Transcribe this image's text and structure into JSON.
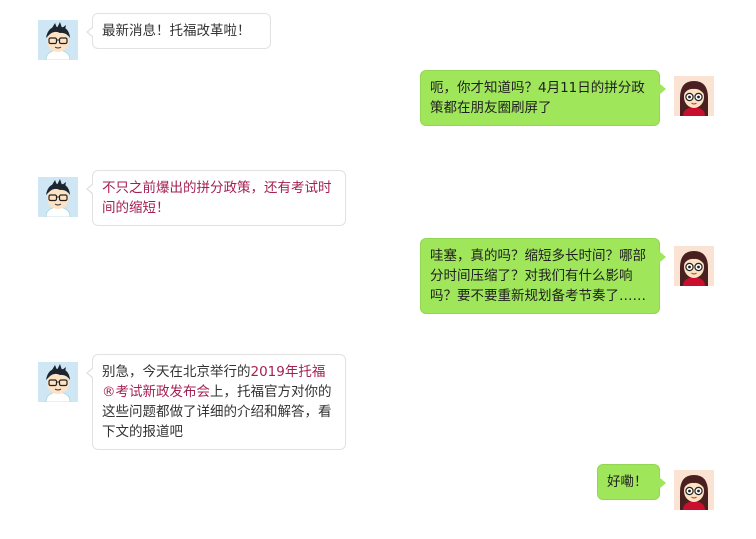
{
  "colors": {
    "left_bubble_bg": "#ffffff",
    "right_bubble_bg": "#9fe65a",
    "highlight_text": "#a51f52"
  },
  "messages": [
    {
      "side": "left",
      "avatar": "boy-avatar",
      "text": "最新消息！托福改革啦！"
    },
    {
      "side": "right",
      "avatar": "girl-avatar",
      "text": "呃，你才知道吗？4月11日的拼分政策都在朋友圈刷屏了"
    },
    {
      "side": "left",
      "avatar": "boy-avatar",
      "text": "不只之前爆出的拼分政策，还有考试时间的缩短！"
    },
    {
      "side": "right",
      "avatar": "girl-avatar",
      "text": "哇塞，真的吗？缩短多长时间？哪部分时间压缩了？对我们有什么影响吗？要不要重新规划备考节奏了……"
    },
    {
      "side": "left",
      "avatar": "boy-avatar",
      "text_before": "别急，今天在北京举行的",
      "text_highlight": "2019年托福®考试新政发布会",
      "text_after": "上，托福官方对你的这些问题都做了详细的介绍和解答，看下文的报道吧"
    },
    {
      "side": "right",
      "avatar": "girl-avatar",
      "text": "好嘞！"
    }
  ]
}
